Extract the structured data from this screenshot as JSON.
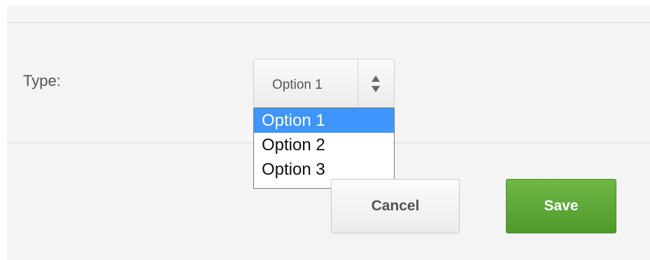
{
  "form": {
    "type_label": "Type:",
    "type_select": {
      "value": "Option 1",
      "options": [
        "Option 1",
        "Option 2",
        "Option 3"
      ],
      "selected_index": 0
    }
  },
  "actions": {
    "cancel_label": "Cancel",
    "save_label": "Save"
  },
  "colors": {
    "background": "#f4f4f4",
    "selection_highlight": "#3e95fb",
    "save_button": "#5aa936"
  },
  "icons": {
    "select_arrows": "up-down-arrows-icon"
  }
}
